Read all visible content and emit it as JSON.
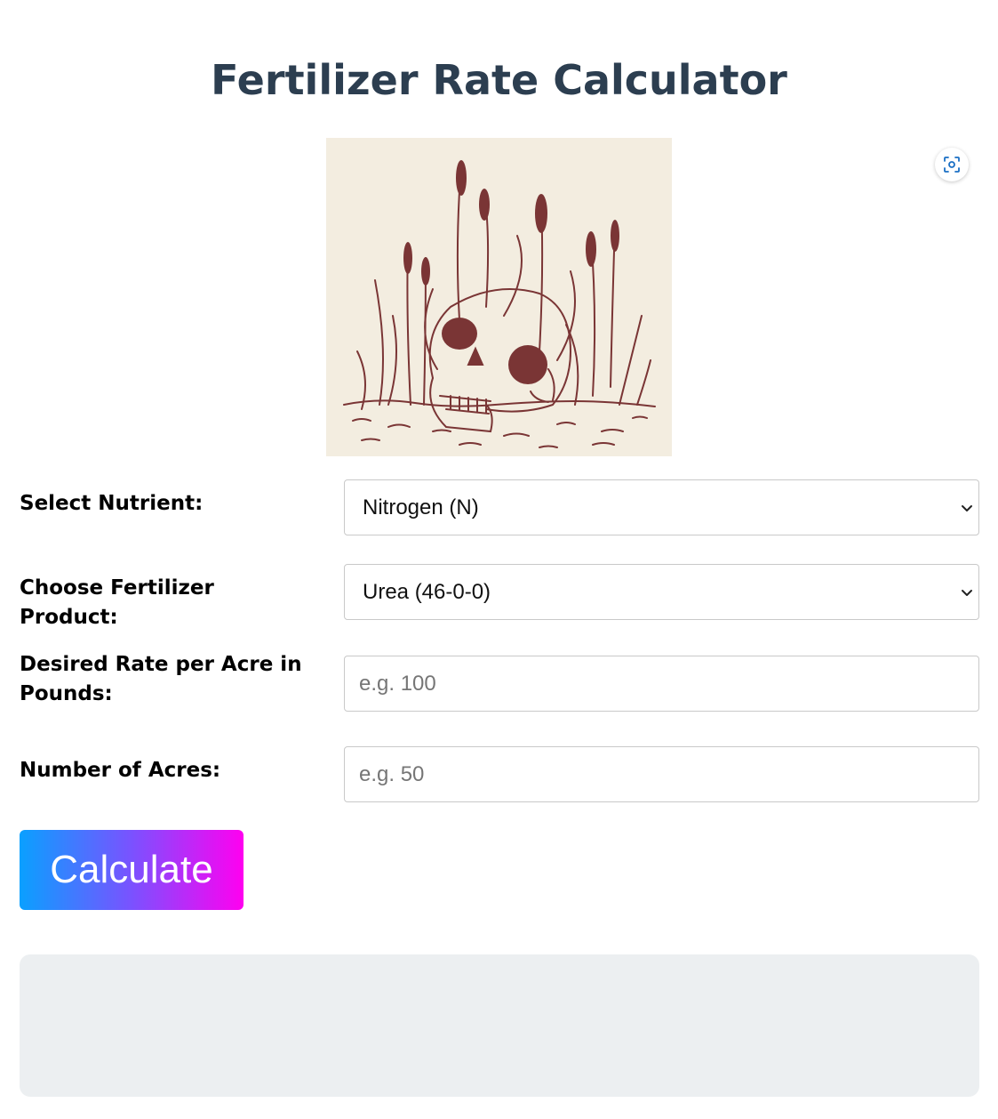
{
  "page": {
    "title": "Fertilizer Rate Calculator"
  },
  "hero_image": {
    "alt": "Illustration of a skull half-buried in soil with wheat stalks growing through it"
  },
  "icons": {
    "scan": "scan-icon",
    "dropdown": "chevron-down-icon"
  },
  "form": {
    "nutrient": {
      "label": "Select Nutrient:",
      "selected": "Nitrogen (N)"
    },
    "product": {
      "label": "Choose Fertilizer Product:",
      "selected": "Urea (46-0-0)"
    },
    "rate": {
      "label": "Desired Rate per Acre in Pounds:",
      "value": "",
      "placeholder": "e.g. 100"
    },
    "acres": {
      "label": "Number of Acres:",
      "value": "",
      "placeholder": "e.g. 50"
    },
    "calculate_label": "Calculate"
  },
  "result": {
    "text": ""
  },
  "colors": {
    "title": "#2c3e50",
    "button_gradient_start": "#0aa0ff",
    "button_gradient_end": "#ff00f0",
    "result_bg": "#eceff1",
    "illustration_ink": "#7a3535",
    "illustration_bg": "#f3ede0"
  }
}
